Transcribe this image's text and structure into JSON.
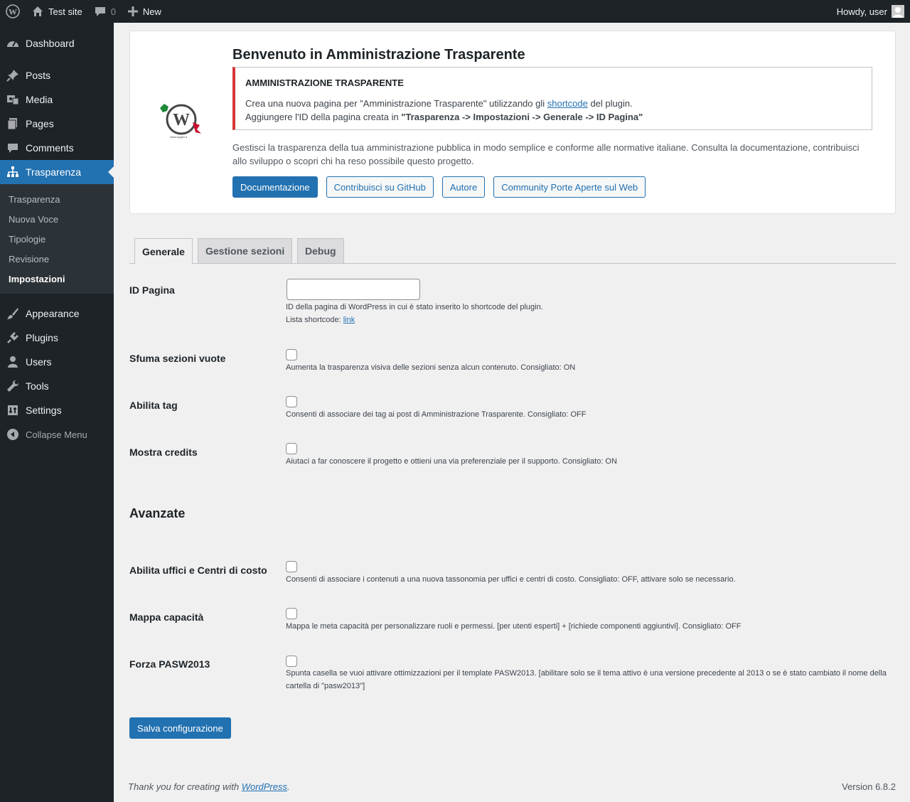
{
  "adminbar": {
    "site_name": "Test site",
    "comments_count": "0",
    "new_label": "New",
    "howdy": "Howdy, user"
  },
  "sidebar": {
    "items_top": [
      {
        "label": "Dashboard",
        "icon": "dashboard-icon"
      },
      {
        "label": "Posts",
        "icon": "pin-icon"
      },
      {
        "label": "Media",
        "icon": "media-icon"
      },
      {
        "label": "Pages",
        "icon": "pages-icon"
      },
      {
        "label": "Comments",
        "icon": "comments-icon"
      }
    ],
    "current": {
      "label": "Trasparenza",
      "icon": "sitemap-icon"
    },
    "submenu": [
      "Trasparenza",
      "Nuova Voce",
      "Tipologie",
      "Revisione",
      "Impostazioni"
    ],
    "items_bottom": [
      {
        "label": "Appearance",
        "icon": "brush-icon"
      },
      {
        "label": "Plugins",
        "icon": "plugin-icon"
      },
      {
        "label": "Users",
        "icon": "user-icon"
      },
      {
        "label": "Tools",
        "icon": "wrench-icon"
      },
      {
        "label": "Settings",
        "icon": "settings-icon"
      }
    ],
    "collapse": "Collapse Menu"
  },
  "welcome": {
    "title": "Benvenuto in Amministrazione Trasparente",
    "notice_title": "AMMINISTRAZIONE TRASPARENTE",
    "notice_line1_pre": "Crea una nuova pagina per \"Amministrazione Trasparente\" utilizzando gli ",
    "notice_line1_link": "shortcode",
    "notice_line1_post": " del plugin.",
    "notice_line2_pre": "Aggiungere l'ID della pagina creata in ",
    "notice_line2_bold": "\"Trasparenza -> Impostazioni -> Generale -> ID Pagina\"",
    "description": "Gestisci la trasparenza della tua amministrazione pubblica in modo semplice e conforme alle normative italiane. Consulta la documentazione, contribuisci allo sviluppo o scopri chi ha reso possibile questo progetto.",
    "buttons": [
      "Documentazione",
      "Contribuisci su GitHub",
      "Autore",
      "Community Porte Aperte sul Web"
    ]
  },
  "tabs": [
    "Generale",
    "Gestione sezioni",
    "Debug"
  ],
  "fields": {
    "id_pagina": {
      "label": "ID Pagina",
      "value": "",
      "help1": "ID della pagina di WordPress in cui è stato inserito lo shortcode del plugin.",
      "help2_pre": "Lista shortcode: ",
      "help2_link": "link"
    },
    "sfuma": {
      "label": "Sfuma sezioni vuote",
      "help": "Aumenta la trasparenza visiva delle sezioni senza alcun contenuto. Consigliato: ON"
    },
    "tag": {
      "label": "Abilita tag",
      "help": "Consenti di associare dei tag ai post di Amministrazione Trasparente. Consigliato: OFF"
    },
    "credits": {
      "label": "Mostra credits",
      "help": "Aiutaci a far conoscere il progetto e ottieni una via preferenziale per il supporto. Consigliato: ON"
    },
    "section_title": "Avanzate",
    "uffici": {
      "label": "Abilita uffici e Centri di costo",
      "help": "Consenti di associare i contenuti a una nuova tassonomia per uffici e centri di costo. Consigliato: OFF, attivare solo se necessario."
    },
    "mappa": {
      "label": "Mappa capacità",
      "help": "Mappa le meta capacità per personalizzare ruoli e permessi. [per utenti esperti] + [richiede componenti aggiuntivi]. Consigliato: OFF"
    },
    "pasw": {
      "label": "Forza PASW2013",
      "help": "Spunta casella se vuoi attivare ottimizzazioni per il template PASW2013. [abilitare solo se il tema attivo è una versione precedente al 2013 o se è stato cambiato il nome della cartella di \"pasw2013\"]"
    }
  },
  "save_label": "Salva configurazione",
  "footer": {
    "thanks_pre": "Thank you for creating with ",
    "thanks_link": "WordPress",
    "thanks_post": ".",
    "version": "Version 6.8.2"
  }
}
